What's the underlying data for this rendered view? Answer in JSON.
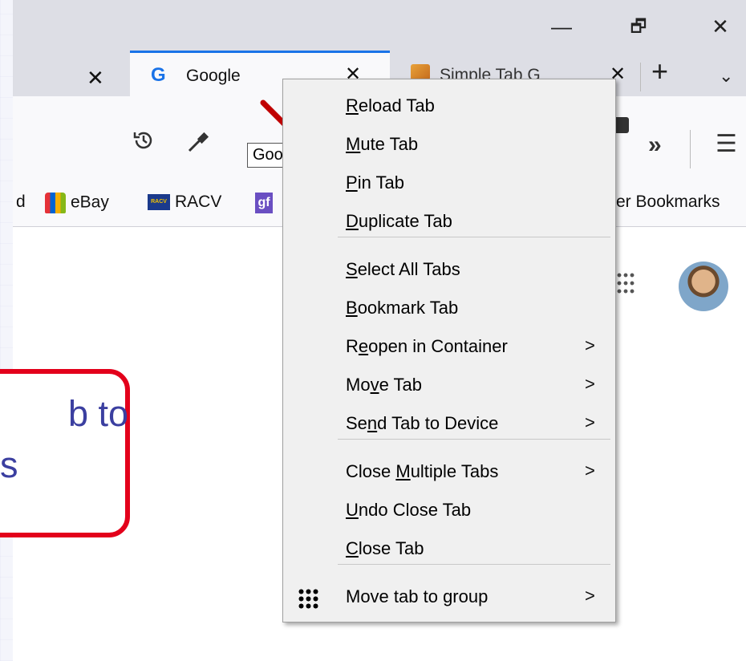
{
  "window": {
    "minimize": "—",
    "restore": "🗗",
    "close": "✕"
  },
  "tabs": {
    "left_close": "✕",
    "active": {
      "favicon": "G",
      "title": "Google",
      "close": "✕"
    },
    "second": {
      "title": "Simple Tab G",
      "close": "✕"
    },
    "new_tab": "+",
    "list_all": "⌄"
  },
  "toolbar": {
    "history_icon": "history-icon",
    "eyedropper_icon": "eyedropper-icon",
    "overflow": "»",
    "menu": "☰"
  },
  "bookmarks": {
    "partial_left": "d",
    "items": [
      {
        "label": "eBay"
      },
      {
        "label": "RACV"
      },
      {
        "label": "gf"
      }
    ],
    "other": "er Bookmarks"
  },
  "tooltip": "Google",
  "callout": {
    "line1": "b to",
    "line2": "s"
  },
  "menu": {
    "groups": [
      [
        {
          "pre": "",
          "u": "R",
          "post": "eload Tab"
        },
        {
          "pre": "",
          "u": "M",
          "post": "ute Tab"
        },
        {
          "pre": "",
          "u": "P",
          "post": "in Tab"
        },
        {
          "pre": "",
          "u": "D",
          "post": "uplicate Tab"
        }
      ],
      [
        {
          "pre": "",
          "u": "S",
          "post": "elect All Tabs"
        },
        {
          "pre": "",
          "u": "B",
          "post": "ookmark Tab"
        },
        {
          "pre": "R",
          "u": "e",
          "post": "open in Container",
          "submenu": true
        },
        {
          "pre": "Mo",
          "u": "v",
          "post": "e Tab",
          "submenu": true
        },
        {
          "pre": "Se",
          "u": "n",
          "post": "d Tab to Device",
          "submenu": true
        }
      ],
      [
        {
          "pre": "Close ",
          "u": "M",
          "post": "ultiple Tabs",
          "submenu": true
        },
        {
          "pre": "",
          "u": "U",
          "post": "ndo Close Tab"
        },
        {
          "pre": "",
          "u": "C",
          "post": "lose Tab"
        }
      ],
      [
        {
          "pre": "Move tab to group",
          "u": "",
          "post": "",
          "submenu": true,
          "icon": "grid-icon"
        }
      ]
    ],
    "submenu_arrow": ">"
  },
  "colors": {
    "accent": "#1a73e8",
    "callout_border": "#e3001b",
    "callout_text": "#3b3fa0"
  }
}
